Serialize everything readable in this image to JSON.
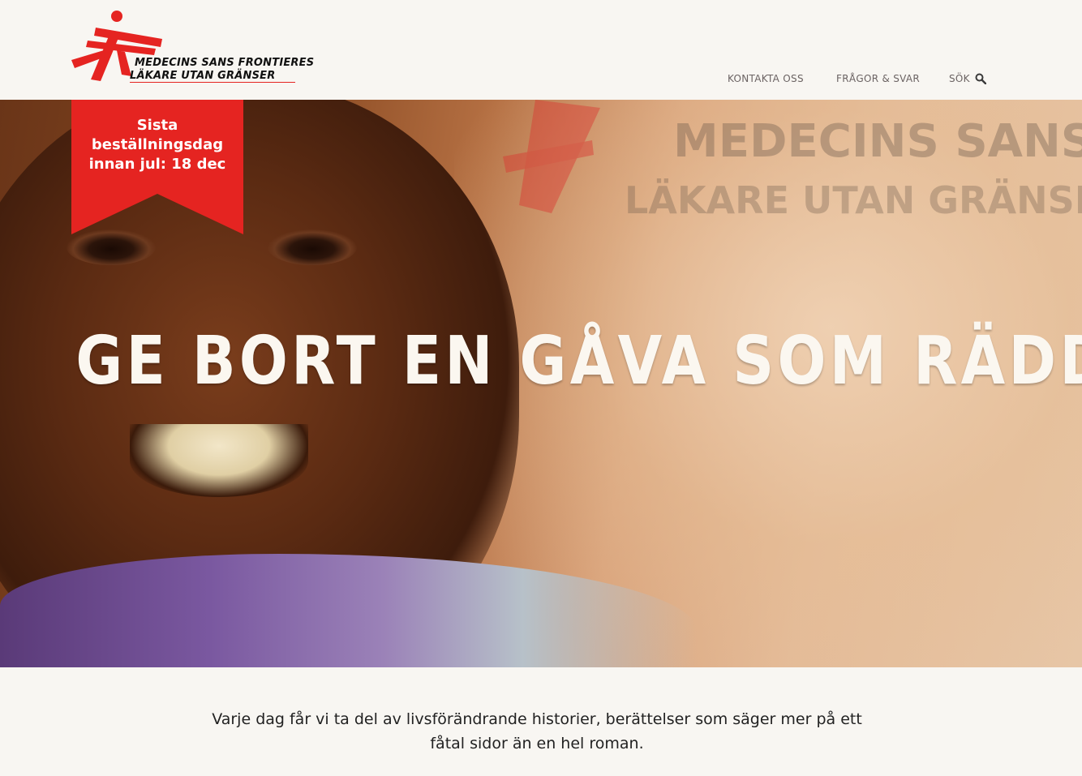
{
  "brand": {
    "logo_icon": "msf-logo-icon",
    "line1": "MEDECINS SANS FRONTIERES",
    "line2": "LÄKARE UTAN GRÄNSER",
    "color": "#e52421"
  },
  "nav": {
    "contact_label": "KONTAKTA OSS",
    "faq_label": "FRÅGOR & SVAR",
    "search_label": "SÖK",
    "search_icon": "search-icon"
  },
  "ribbon": {
    "line1": "Sista",
    "line2": "beställningsdag",
    "line3": "innan jul: 18 dec",
    "color": "#e52421"
  },
  "hero": {
    "title": "GE BORT EN GÅVA SOM RÄDDAR LIV",
    "sign_text_1": "MEDECINS SANS",
    "sign_text_2": "LÄKARE UTAN GRÄNSER"
  },
  "intro": {
    "text": "Varje dag får vi ta del av livsförändrande historier, berättelser som säger mer på ett fåtal sidor än en hel roman."
  }
}
